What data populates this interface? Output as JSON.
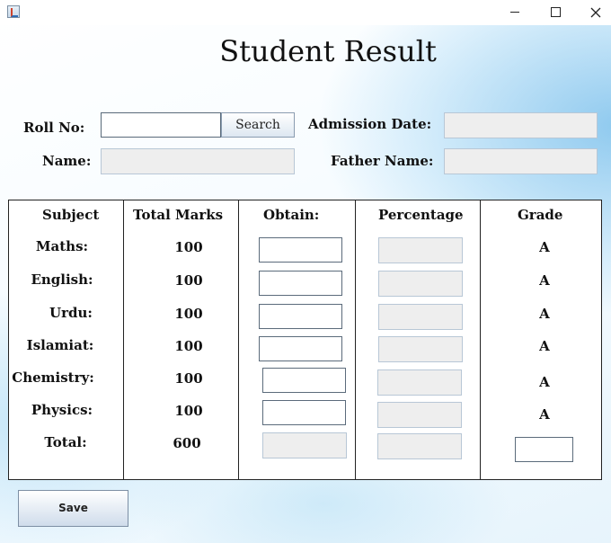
{
  "window": {
    "title": "",
    "icon": "java-icon",
    "controls": [
      "minimize-icon",
      "maximize-icon",
      "close-icon"
    ]
  },
  "page_title": "Student Result",
  "form": {
    "roll_no_label": "Roll No:",
    "roll_no_value": "",
    "search_label": "Search",
    "admission_date_label": "Admission Date:",
    "admission_date_value": "",
    "name_label": "Name:",
    "name_value": "",
    "father_name_label": "Father Name:",
    "father_name_value": ""
  },
  "table": {
    "headers": {
      "subject": "Subject",
      "total": "Total Marks",
      "obtain": "Obtain:",
      "percentage": "Percentage",
      "grade": "Grade"
    },
    "rows": [
      {
        "subject": "Maths:",
        "total": "100",
        "obtain": "",
        "percentage": "",
        "grade": "A"
      },
      {
        "subject": "English:",
        "total": "100",
        "obtain": "",
        "percentage": "",
        "grade": "A"
      },
      {
        "subject": "Urdu:",
        "total": "100",
        "obtain": "",
        "percentage": "",
        "grade": "A"
      },
      {
        "subject": "Islamiat:",
        "total": "100",
        "obtain": "",
        "percentage": "",
        "grade": "A"
      },
      {
        "subject": "Chemistry:",
        "total": "100",
        "obtain": "",
        "percentage": "",
        "grade": "A"
      },
      {
        "subject": "Physics:",
        "total": "100",
        "obtain": "",
        "percentage": "",
        "grade": "A"
      }
    ],
    "total_row": {
      "subject": "Total:",
      "total": "600",
      "obtain": "",
      "percentage": "",
      "grade": ""
    }
  },
  "save_label": "Save"
}
